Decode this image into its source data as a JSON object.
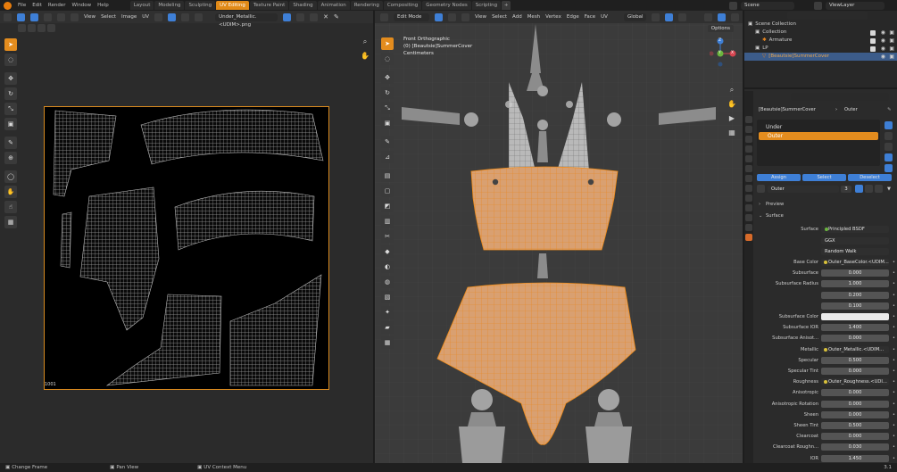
{
  "app": {
    "menu": [
      "File",
      "Edit",
      "Render",
      "Window",
      "Help"
    ],
    "workspace_tabs": [
      "Layout",
      "Modeling",
      "Sculpting",
      "UV Editing",
      "Texture Paint",
      "Shading",
      "Animation",
      "Rendering",
      "Compositing",
      "Geometry Nodes",
      "Scripting"
    ],
    "active_tab": "UV Editing",
    "scene": "Scene",
    "view_layer": "ViewLayer"
  },
  "uv_editor": {
    "menu": [
      "View",
      "Select",
      "Image",
      "UV"
    ],
    "image_name": "Under_Metallic.<UDIM>.png",
    "udim_label": "1001"
  },
  "viewport": {
    "mode": "Edit Mode",
    "menu": [
      "View",
      "Select",
      "Add",
      "Mesh",
      "Vertex",
      "Edge",
      "Face",
      "UV"
    ],
    "transform": "Global",
    "options": "Options",
    "overlay": [
      "Front Orthographic",
      "(0) [Beautsie]SummerCover",
      "Centimeters"
    ],
    "gizmo": {
      "z": "Z",
      "y": "Y",
      "x": "X"
    }
  },
  "outliner": {
    "rows": [
      {
        "label": "Scene Collection",
        "indent": 0
      },
      {
        "label": "Collection",
        "indent": 1
      },
      {
        "label": "Armature",
        "indent": 2
      },
      {
        "label": "LP",
        "indent": 1
      },
      {
        "label": "[Beautsie]SummerCover",
        "indent": 2,
        "selected": true
      }
    ]
  },
  "properties": {
    "breadcrumb_object": "[Beautsie]SummerCover",
    "breadcrumb_material": "Outer",
    "materials": [
      "Under",
      "Outer"
    ],
    "active_material": "Outer",
    "slot_buttons": {
      "assign": "Assign",
      "select": "Select",
      "deselect": "Deselect"
    },
    "material_name": "Outer",
    "users": "3",
    "panels": {
      "preview": "Preview",
      "surface": "Surface"
    },
    "surface_shader": "Principled BSDF",
    "rows": [
      {
        "label": "",
        "value": "GGX",
        "kind": "plain"
      },
      {
        "label": "",
        "value": "Random Walk",
        "kind": "plain"
      },
      {
        "label": "Base Color",
        "value": "Outer_BaseColor.<UDIM...",
        "kind": "tex"
      },
      {
        "label": "Subsurface",
        "value": "0.000",
        "kind": "num"
      },
      {
        "label": "Subsurface Radius",
        "value": "1.000",
        "kind": "num"
      },
      {
        "label": "",
        "value": "0.200",
        "kind": "num"
      },
      {
        "label": "",
        "value": "0.100",
        "kind": "num"
      },
      {
        "label": "Subsurface Color",
        "value": "",
        "kind": "white"
      },
      {
        "label": "Subsurface IOR",
        "value": "1.400",
        "kind": "num"
      },
      {
        "label": "Subsurface Anisot...",
        "value": "0.000",
        "kind": "num"
      },
      {
        "label": "Metallic",
        "value": "Outer_Metallic.<UDIM...",
        "kind": "tex"
      },
      {
        "label": "Specular",
        "value": "0.500",
        "kind": "num"
      },
      {
        "label": "Specular Tint",
        "value": "0.000",
        "kind": "num"
      },
      {
        "label": "Roughness",
        "value": "Outer_Roughness.<UDI...",
        "kind": "tex"
      },
      {
        "label": "Anisotropic",
        "value": "0.000",
        "kind": "num"
      },
      {
        "label": "Anisotropic Rotation",
        "value": "0.000",
        "kind": "num"
      },
      {
        "label": "Sheen",
        "value": "0.000",
        "kind": "num"
      },
      {
        "label": "Sheen Tint",
        "value": "0.500",
        "kind": "num"
      },
      {
        "label": "Clearcoat",
        "value": "0.000",
        "kind": "num"
      },
      {
        "label": "Clearcoat Roughn...",
        "value": "0.030",
        "kind": "num"
      },
      {
        "label": "IOR",
        "value": "1.450",
        "kind": "num"
      }
    ]
  },
  "statusbar": {
    "left": "Change Frame",
    "mid": "Pan View",
    "right": "UV Context Menu",
    "version": "3.1"
  }
}
